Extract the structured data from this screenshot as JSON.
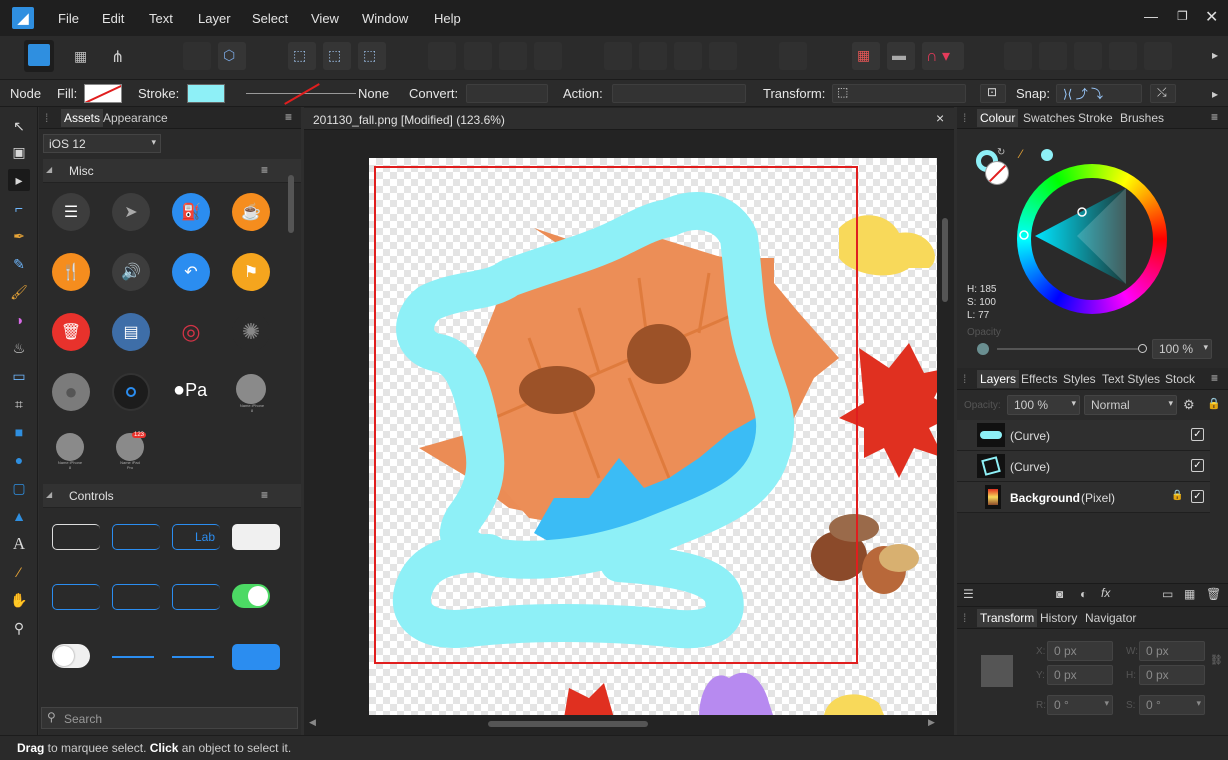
{
  "menu": {
    "items": [
      "File",
      "Edit",
      "Text",
      "Layer",
      "Select",
      "View",
      "Window",
      "Help"
    ]
  },
  "context": {
    "node_label": "Node",
    "fill_label": "Fill:",
    "stroke_label": "Stroke:",
    "stroke_none": "None",
    "convert_label": "Convert:",
    "action_label": "Action:",
    "transform_label": "Transform:",
    "snap_label": "Snap:"
  },
  "assets": {
    "tabs": [
      "Assets",
      "Appearance"
    ],
    "category": "iOS 12",
    "section_misc": "Misc",
    "section_controls": "Controls",
    "search_placeholder": "Search",
    "phone_labels": [
      "Name iPhone 8",
      "Name iPhone 8",
      "Name iPad Pro"
    ],
    "badge": "123",
    "apple_text": "Pa",
    "lab_text": "Lab"
  },
  "document": {
    "tab_title": "201130_fall.png [Modified] (123.6%)",
    "close": "×"
  },
  "colour": {
    "tabs": [
      "Colour",
      "Swatches",
      "Stroke",
      "Brushes"
    ],
    "h": "H: 185",
    "s": "S: 100",
    "l": "L: 77",
    "opacity_label": "Opacity",
    "opacity_value": "100 %"
  },
  "layers": {
    "tabs": [
      "Layers",
      "Effects",
      "Styles",
      "Text Styles",
      "Stock"
    ],
    "opacity_label": "Opacity:",
    "opacity_value": "100 %",
    "blend": "Normal",
    "rows": [
      {
        "name": "(Curve)",
        "kind": ""
      },
      {
        "name": "(Curve)",
        "kind": ""
      },
      {
        "name": "Background",
        "kind": " (Pixel)"
      }
    ]
  },
  "transform": {
    "tabs": [
      "Transform",
      "History",
      "Navigator"
    ],
    "x_label": "X:",
    "y_label": "Y:",
    "w_label": "W:",
    "h_label": "H:",
    "r_label": "R:",
    "s_label": "S:",
    "x": "0 px",
    "y": "0 px",
    "w": "0 px",
    "h": "0 px",
    "r": "0 °",
    "s": "0 °"
  },
  "status": {
    "drag": "Drag",
    "drag_text": " to marquee select. ",
    "click": "Click",
    "click_text": " an object to select it."
  },
  "colors": {
    "accent": "#2f8fe0",
    "cyan": "#8ef0f7",
    "selection": "#e01e1e",
    "leaf": "#eb8c55",
    "leaf_dark": "#df7b3d",
    "blue": "#3bbcf5"
  }
}
